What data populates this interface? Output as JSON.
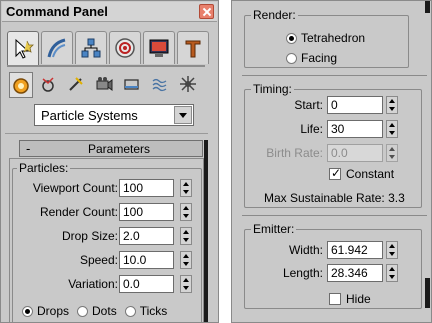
{
  "command_panel": {
    "title": "Command Panel",
    "tabs": [
      {
        "icon": "create-icon",
        "active": true
      },
      {
        "icon": "modify-icon",
        "active": false
      },
      {
        "icon": "hierarchy-icon",
        "active": false
      },
      {
        "icon": "motion-icon",
        "active": false
      },
      {
        "icon": "display-icon",
        "active": false
      },
      {
        "icon": "utilities-icon",
        "active": false
      }
    ],
    "object_types": [
      {
        "icon": "geometry-icon",
        "active": true
      },
      {
        "icon": "shapes-icon",
        "active": false
      },
      {
        "icon": "lights-icon",
        "active": false
      },
      {
        "icon": "cameras-icon",
        "active": false
      },
      {
        "icon": "helpers-icon",
        "active": false
      },
      {
        "icon": "space-warps-icon",
        "active": false
      },
      {
        "icon": "systems-icon",
        "active": false
      }
    ],
    "category_select": {
      "value": "Particle Systems"
    },
    "rollout": {
      "toggle": "-",
      "title": "Parameters"
    },
    "particles": {
      "label": "Particles:",
      "fields": [
        {
          "label": "Viewport Count:",
          "value": "100"
        },
        {
          "label": "Render Count:",
          "value": "100"
        },
        {
          "label": "Drop Size:",
          "value": "2.0"
        },
        {
          "label": "Speed:",
          "value": "10.0"
        },
        {
          "label": "Variation:",
          "value": "0.0"
        }
      ],
      "display_modes": [
        {
          "label": "Drops",
          "selected": true
        },
        {
          "label": "Dots",
          "selected": false
        },
        {
          "label": "Ticks",
          "selected": false
        }
      ]
    }
  },
  "right_panel": {
    "render": {
      "label": "Render:",
      "options": [
        {
          "label": "Tetrahedron",
          "selected": true
        },
        {
          "label": "Facing",
          "selected": false
        }
      ]
    },
    "timing": {
      "label": "Timing:",
      "start": {
        "label": "Start:",
        "value": "0"
      },
      "life": {
        "label": "Life:",
        "value": "30"
      },
      "birth_rate": {
        "label": "Birth Rate:",
        "value": "0.0",
        "disabled": true
      },
      "constant": {
        "label": "Constant",
        "checked": true
      },
      "max_rate_text": "Max Sustainable Rate: 3.3"
    },
    "emitter": {
      "label": "Emitter:",
      "width": {
        "label": "Width:",
        "value": "61.942"
      },
      "length": {
        "label": "Length:",
        "value": "28.346"
      },
      "hide": {
        "label": "Hide",
        "checked": false
      }
    }
  }
}
